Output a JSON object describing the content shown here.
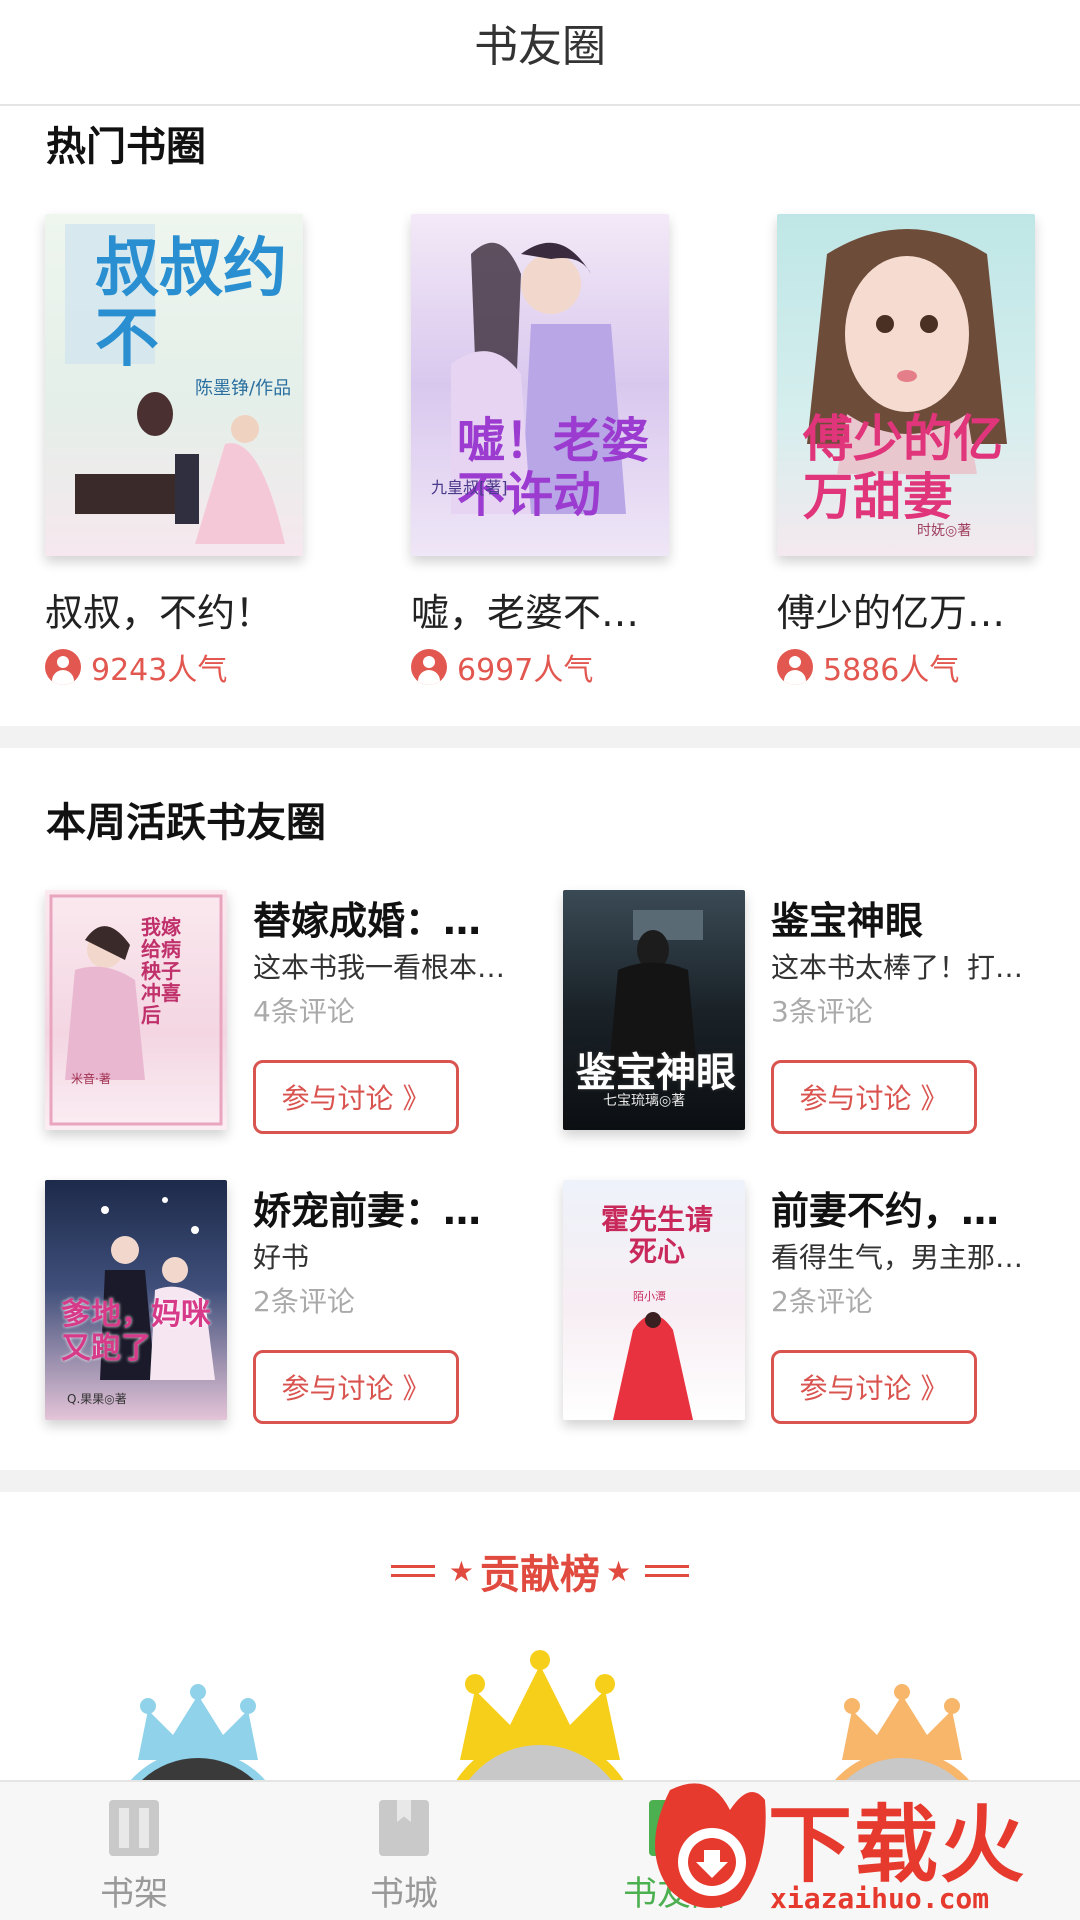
{
  "header": {
    "title": "书友圈"
  },
  "hot": {
    "title": "热门书圈",
    "items": [
      {
        "name": "叔叔，不约！",
        "popularity": "9243人气",
        "cover_title": "叔叔约不",
        "cover_sub": "陈墨铮/作品"
      },
      {
        "name": "嘘，老婆不…",
        "popularity": "6997人气",
        "cover_title": "嘘！老婆不许动",
        "cover_sub": "九皇叔[著]"
      },
      {
        "name": "傅少的亿万…",
        "popularity": "5886人气",
        "cover_title": "傅少的亿万甜妻",
        "cover_sub": "时妩◎著"
      }
    ]
  },
  "active": {
    "title": "本周活跃书友圈",
    "button_label": "参与讨论 》",
    "items": [
      {
        "title": "替嫁成婚：…",
        "desc": "这本书我一看根本…",
        "comments": "4条评论",
        "cover_title": "我嫁给病秧子冲喜后",
        "cover_sub": "米音·著"
      },
      {
        "title": "鉴宝神眼",
        "desc": "这本书太棒了！打…",
        "comments": "3条评论",
        "cover_title": "鉴宝神眼",
        "cover_sub": "七宝琉璃◎著"
      },
      {
        "title": "娇宠前妻：…",
        "desc": "好书",
        "comments": "2条评论",
        "cover_title": "爹地，妈咪又跑了",
        "cover_sub": "Q.果果◎著"
      },
      {
        "title": "前妻不约，…",
        "desc": "看得生气，男主那…",
        "comments": "2条评论",
        "cover_title": "霍先生请死心",
        "cover_sub": "陌小潭"
      }
    ]
  },
  "contrib": {
    "title": "贡献榜",
    "star": "★"
  },
  "nav": {
    "items": [
      {
        "label": "书架"
      },
      {
        "label": "书城"
      },
      {
        "label": "书友圈"
      }
    ]
  },
  "watermark": {
    "text": "下载火",
    "url": "xiazaihuo.com"
  },
  "colors": {
    "accent": "#e2574f",
    "contrib": "#e04a3f"
  }
}
